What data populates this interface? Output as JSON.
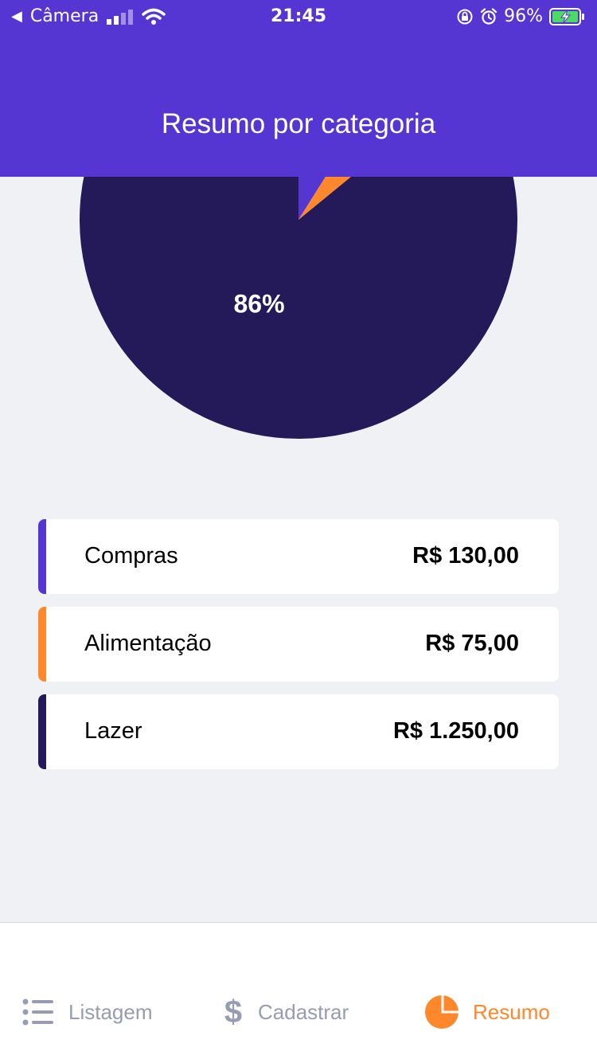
{
  "status_bar": {
    "back_app": "Câmera",
    "time": "21:45",
    "battery": "96%"
  },
  "header": {
    "title": "Resumo por categoria"
  },
  "chart_data": {
    "type": "pie",
    "slices": [
      {
        "label": "Compras",
        "value": 130.0,
        "color": "#5636d3"
      },
      {
        "label": "Alimentação",
        "value": 75.0,
        "color": "#ff872c"
      },
      {
        "label": "Lazer",
        "value": 1250.0,
        "color": "#241a5a"
      }
    ],
    "data_labels": [
      {
        "slice": "Lazer",
        "text": "86%"
      }
    ]
  },
  "categories": [
    {
      "name": "Compras",
      "amount": "R$ 130,00",
      "color": "#5636d3"
    },
    {
      "name": "Alimentação",
      "amount": "R$ 75,00",
      "color": "#ff872c"
    },
    {
      "name": "Lazer",
      "amount": "R$ 1.250,00",
      "color": "#241a5a"
    }
  ],
  "tabs": [
    {
      "label": "Listagem",
      "icon": "list-icon",
      "active": false
    },
    {
      "label": "Cadastrar",
      "icon": "dollar-icon",
      "active": false
    },
    {
      "label": "Resumo",
      "icon": "pie-chart-icon",
      "active": true
    }
  ],
  "colors": {
    "primary": "#5636d3",
    "secondary": "#ff872c",
    "dark": "#241a5a",
    "background": "#f0f1f5",
    "inactive": "#969cb2"
  }
}
